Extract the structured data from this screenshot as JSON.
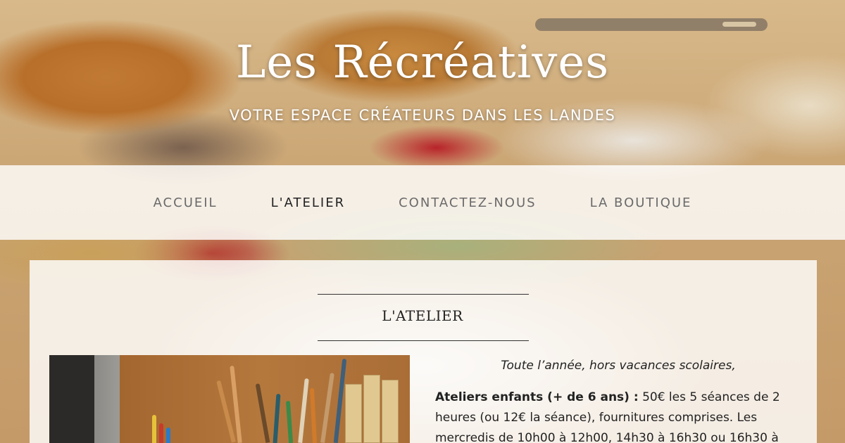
{
  "header": {
    "site_title": "Les Récréatives",
    "tagline": "VOTRE ESPACE CRÉATEURS DANS LES LANDES"
  },
  "nav": {
    "items": [
      {
        "label": "ACCUEIL",
        "active": false
      },
      {
        "label": "L'ATELIER",
        "active": true
      },
      {
        "label": "CONTACTEZ-NOUS",
        "active": false
      },
      {
        "label": "LA BOUTIQUE",
        "active": false
      }
    ]
  },
  "main": {
    "title": "L'ATELIER",
    "intro": "Toute l’année, hors vacances scolaires,",
    "ateliers_enfants": {
      "label": "Ateliers enfants (+ de 6 ans) :",
      "text": " 50€ les 5 séances de 2 heures (ou 12€ la séance), fournitures comprises. Les mercredis de 10h00 à 12h00, 14h30 à 16h30 ou 16h30 à"
    },
    "photo_alt": "Pinceaux et crayons"
  },
  "colors": {
    "nav_active": "#222222",
    "nav_inactive": "#6a6a6a",
    "panel_bg": "rgba(255,255,255,0.82)"
  }
}
